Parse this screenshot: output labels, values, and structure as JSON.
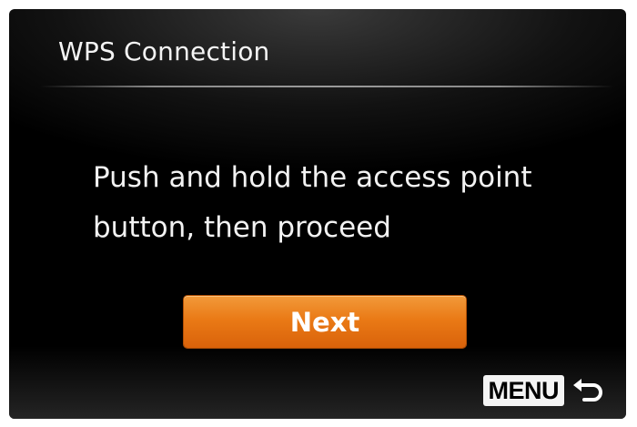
{
  "header": {
    "title": "WPS Connection"
  },
  "message": {
    "line1": "Push and hold the access point",
    "line2": "button, then proceed"
  },
  "actions": {
    "next_label": "Next"
  },
  "footer": {
    "menu_label": "MENU",
    "back_icon": "return-arrow-icon"
  },
  "colors": {
    "accent": "#ea7a16",
    "text": "#f2f2f2",
    "background": "#000000"
  }
}
